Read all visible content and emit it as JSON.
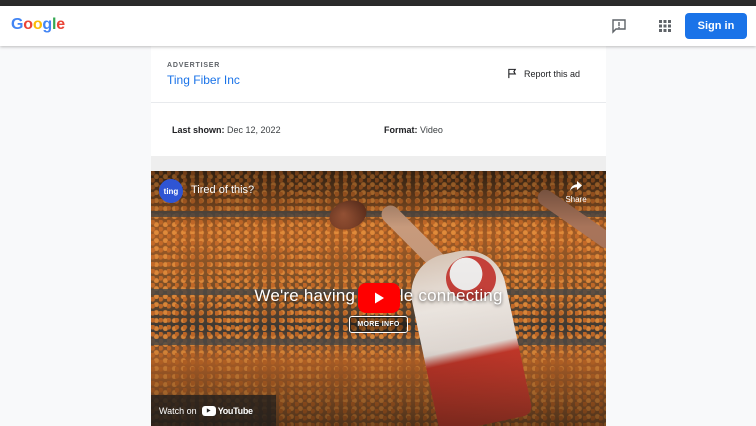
{
  "header": {
    "logo_letters": [
      "G",
      "o",
      "o",
      "g",
      "l",
      "e"
    ],
    "logo_colors": [
      "#4285f4",
      "#ea4335",
      "#fbbc05",
      "#4285f4",
      "#34a853",
      "#ea4335"
    ],
    "signin_label": "Sign in",
    "icons": [
      "feedback-icon",
      "apps-grid-icon"
    ]
  },
  "advertiser": {
    "label": "ADVERTISER",
    "name": "Ting Fiber Inc",
    "report_label": "Report this ad"
  },
  "meta": {
    "last_shown_label": "Last shown:",
    "last_shown_value": "Dec 12, 2022",
    "format_label": "Format:",
    "format_value": "Video"
  },
  "video": {
    "channel_avatar_text": "ting",
    "title": "Tired of this?",
    "share_label": "Share",
    "caption": "We're having trouble connecting",
    "more_info_label": "MORE INFO",
    "watch_on_label": "Watch on",
    "youtube_label": "YouTube"
  }
}
